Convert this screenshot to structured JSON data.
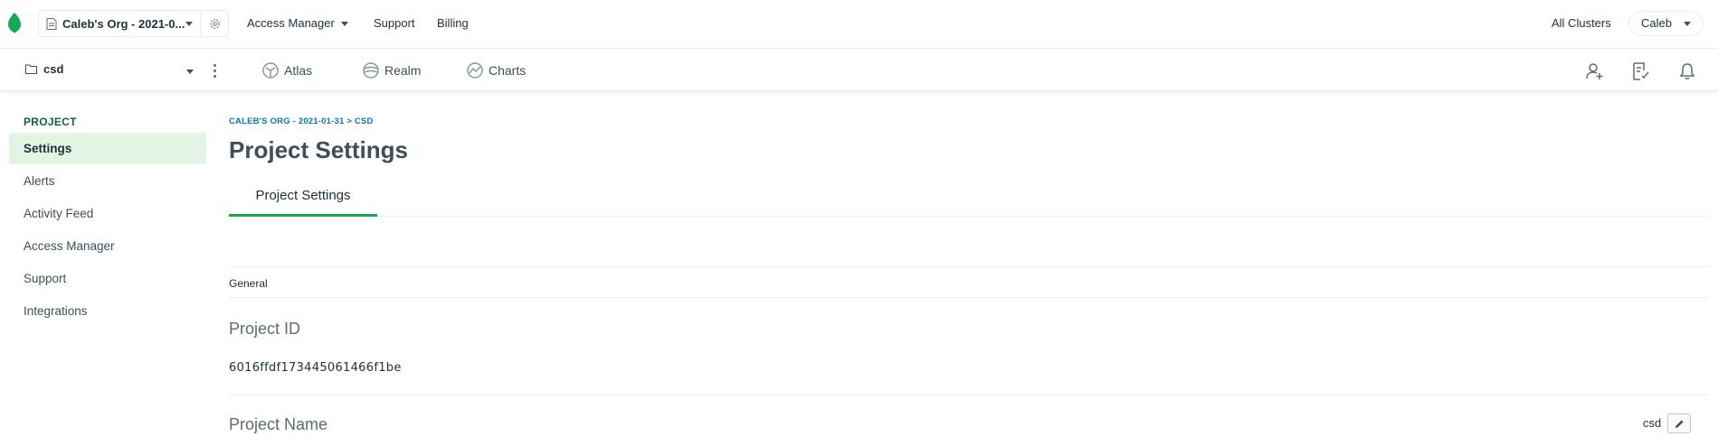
{
  "topbar": {
    "org_name": "Caleb's Org - 2021-0...",
    "links": {
      "access_manager": "Access Manager",
      "support": "Support",
      "billing": "Billing"
    },
    "all_clusters": "All Clusters",
    "user": "Caleb"
  },
  "subbar": {
    "project": "csd",
    "products": {
      "atlas": "Atlas",
      "realm": "Realm",
      "charts": "Charts"
    }
  },
  "sidebar": {
    "heading": "PROJECT",
    "items": [
      {
        "label": "Settings",
        "active": true
      },
      {
        "label": "Alerts",
        "active": false
      },
      {
        "label": "Activity Feed",
        "active": false
      },
      {
        "label": "Access Manager",
        "active": false
      },
      {
        "label": "Support",
        "active": false
      },
      {
        "label": "Integrations",
        "active": false
      }
    ]
  },
  "main": {
    "breadcrumb": "CALEB'S ORG - 2021-01-31 > CSD",
    "title": "Project Settings",
    "tabs": [
      {
        "label": "Project Settings",
        "active": true
      }
    ],
    "section": "General",
    "project_id_label": "Project ID",
    "project_id": "6016ffdf173445061466f1be",
    "project_name_label": "Project Name",
    "project_name": "csd"
  },
  "colors": {
    "brand_green": "#13aa52",
    "active_bg": "#e4f4e4",
    "link_blue": "#007cad"
  },
  "icons": [
    "leaf-logo-icon",
    "document-icon",
    "gear-icon",
    "folder-icon",
    "kebab-menu-icon",
    "atlas-icon",
    "realm-icon",
    "charts-icon",
    "add-user-icon",
    "activity-icon",
    "bell-icon",
    "pencil-icon"
  ]
}
